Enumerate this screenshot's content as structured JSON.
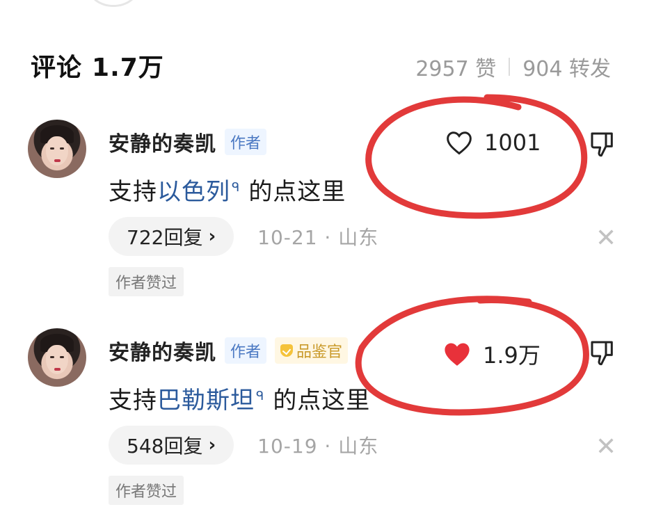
{
  "header": {
    "title": "评论",
    "title_count": "1.7万",
    "likes": "2957 赞",
    "reposts": "904 转发"
  },
  "comments": [
    {
      "username": "安静的奏凯",
      "badge_author": "作者",
      "badge_critic": "",
      "text_before": "支持",
      "text_link": "以色列",
      "text_after": "的点这里",
      "like_count": "1001",
      "liked": false,
      "reply_label": "722回复",
      "time_location": "10-21 · 山东",
      "author_liked_tag": "作者赞过",
      "icons": [
        "heart-outline-icon",
        "thumbs-down-icon",
        "close-icon",
        "chevron-right-icon",
        "search-icon"
      ]
    },
    {
      "username": "安静的奏凯",
      "badge_author": "作者",
      "badge_critic": "品鉴官",
      "text_before": "支持",
      "text_link": "巴勒斯坦",
      "text_after": "的点这里",
      "like_count": "1.9万",
      "liked": true,
      "reply_label": "548回复",
      "time_location": "10-19 · 山东",
      "author_liked_tag": "作者赞过",
      "icons": [
        "heart-filled-icon",
        "thumbs-down-icon",
        "close-icon",
        "chevron-right-icon",
        "search-icon"
      ]
    }
  ],
  "colors": {
    "link": "#2b5a9c",
    "liked_heart": "#e8313a",
    "annotation_circle": "#e23a3a",
    "author_badge_bg": "#eef5ff",
    "critic_badge_bg": "#fff7e3"
  }
}
